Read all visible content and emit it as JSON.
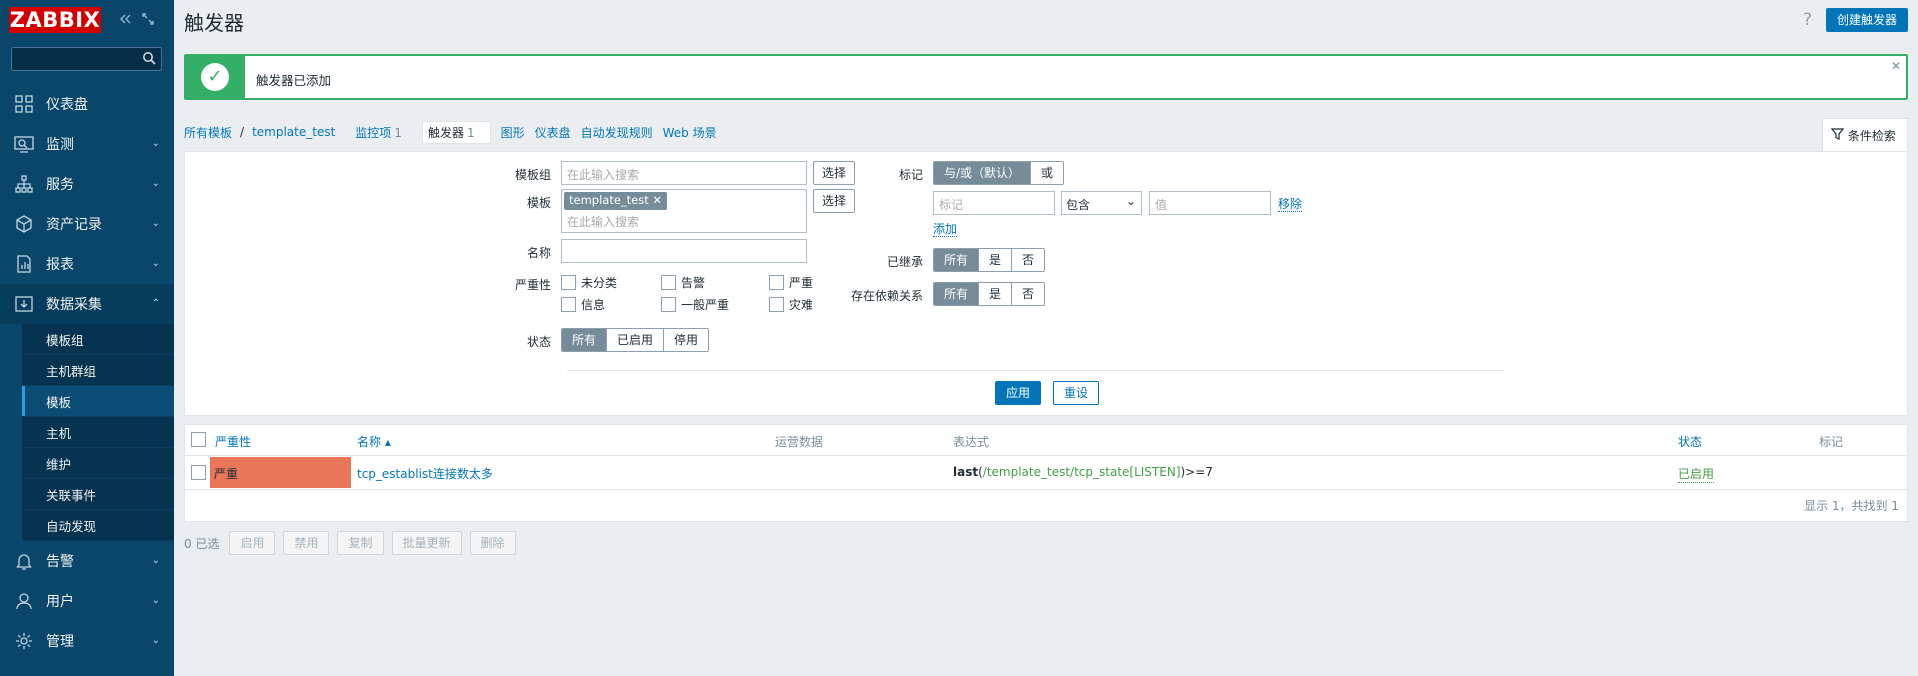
{
  "app": {
    "logo": "ZABBIX",
    "collapse_icon": "chevrons-left-icon",
    "kiosk_icon": "fullscreen-icon"
  },
  "sidebar": {
    "search_placeholder": "",
    "items": [
      {
        "label": "仪表盘",
        "icon": "dashboard-icon"
      },
      {
        "label": "监测",
        "icon": "monitor-icon"
      },
      {
        "label": "服务",
        "icon": "services-icon"
      },
      {
        "label": "资产记录",
        "icon": "inventory-icon"
      },
      {
        "label": "报表",
        "icon": "reports-icon"
      },
      {
        "label": "数据采集",
        "icon": "datacollection-icon"
      },
      {
        "label": "告警",
        "icon": "bell-icon"
      },
      {
        "label": "用户",
        "icon": "user-icon"
      },
      {
        "label": "管理",
        "icon": "gear-icon"
      }
    ],
    "submenu": [
      "模板组",
      "主机群组",
      "模板",
      "主机",
      "维护",
      "关联事件",
      "自动发现"
    ]
  },
  "header": {
    "title": "触发器",
    "help": "?",
    "create_button": "创建触发器"
  },
  "message": {
    "text": "触发器已添加"
  },
  "breadcrumb": {
    "all_templates": "所有模板",
    "separator": "/",
    "template": "template_test",
    "items": "监控项",
    "items_count": "1",
    "triggers": "触发器",
    "triggers_count": "1",
    "graphs": "图形",
    "dashboards": "仪表盘",
    "discovery": "自动发现规则",
    "web": "Web 场景"
  },
  "filter": {
    "tab_label": "条件检索",
    "template_group_label": "模板组",
    "template_group_placeholder": "在此输入搜索",
    "select_button": "选择",
    "template_label": "模板",
    "template_chip": "template_test",
    "template_placeholder": "在此输入搜索",
    "name_label": "名称",
    "severity_label": "严重性",
    "severities": [
      "未分类",
      "告警",
      "严重",
      "信息",
      "一般严重",
      "灾难"
    ],
    "state_label": "状态",
    "state_options": [
      "所有",
      "已启用",
      "停用"
    ],
    "tags_label": "标记",
    "tags_mode": [
      "与/或（默认）",
      "或"
    ],
    "tag_placeholder": "标记",
    "tag_operator": "包含",
    "value_placeholder": "值",
    "remove_link": "移除",
    "add_link": "添加",
    "inherited_label": "已继承",
    "inherited_options": [
      "所有",
      "是",
      "否"
    ],
    "dependencies_label": "存在依赖关系",
    "dependencies_options": [
      "所有",
      "是",
      "否"
    ],
    "apply_button": "应用",
    "reset_button": "重设"
  },
  "table": {
    "columns": [
      "严重性",
      "名称 ▴",
      "运营数据",
      "表达式",
      "状态",
      "标记"
    ],
    "rows": [
      {
        "severity": "严重",
        "severity_color": "#e97659",
        "name": "tcp_establist连接数太多",
        "opdata": "",
        "expr_fn": "last",
        "expr_open": "(",
        "expr_item": "/template_test/tcp_state[LISTEN]",
        "expr_close": ")>=7",
        "status": "已启用",
        "tags": ""
      }
    ],
    "footer": "显示 1，共找到 1"
  },
  "actions": {
    "selected": "0 已选",
    "buttons": [
      "启用",
      "禁用",
      "复制",
      "批量更新",
      "删除"
    ]
  }
}
